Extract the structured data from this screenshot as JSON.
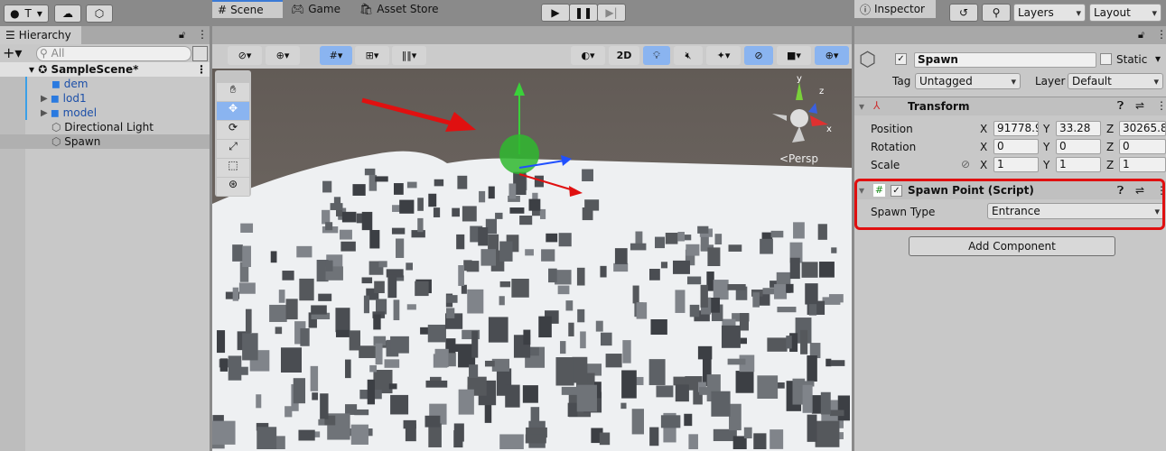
{
  "toolbar": {
    "account_label": "T",
    "layers_label": "Layers",
    "layout_label": "Layout"
  },
  "hierarchy": {
    "tab": "Hierarchy",
    "search_placeholder": "All",
    "scene": "SampleScene*",
    "items": [
      {
        "label": "dem",
        "prefab": true
      },
      {
        "label": "lod1",
        "prefab": true
      },
      {
        "label": "model",
        "prefab": true
      },
      {
        "label": "Directional Light",
        "prefab": false
      },
      {
        "label": "Spawn",
        "prefab": false,
        "selected": true
      }
    ]
  },
  "scene_tabs": {
    "scene": "Scene",
    "game": "Game",
    "asset_store": "Asset Store"
  },
  "scene_toolbar": {
    "mode_2d": "2D"
  },
  "scene_view": {
    "persp_label": "<Persp",
    "gizmo_axes": [
      "y",
      "z",
      "x"
    ]
  },
  "inspector": {
    "tab": "Inspector",
    "object_name": "Spawn",
    "active": true,
    "static_label": "Static",
    "static": false,
    "tag_label": "Tag",
    "tag": "Untagged",
    "layer_label": "Layer",
    "layer": "Default",
    "transform": {
      "title": "Transform",
      "position_label": "Position",
      "rotation_label": "Rotation",
      "scale_label": "Scale",
      "position": {
        "x": "91778.9",
        "y": "33.28",
        "z": "30265.8"
      },
      "rotation": {
        "x": "0",
        "y": "0",
        "z": "0"
      },
      "scale": {
        "x": "1",
        "y": "1",
        "z": "1"
      }
    },
    "spawn_point": {
      "title": "Spawn Point (Script)",
      "enabled": true,
      "field_label": "Spawn Type",
      "field_value": "Entrance"
    },
    "add_component": "Add Component"
  },
  "colors": {
    "highlight": "#e01010",
    "accent": "#3a7ad6",
    "prefab_text": "#1c4fa8"
  }
}
